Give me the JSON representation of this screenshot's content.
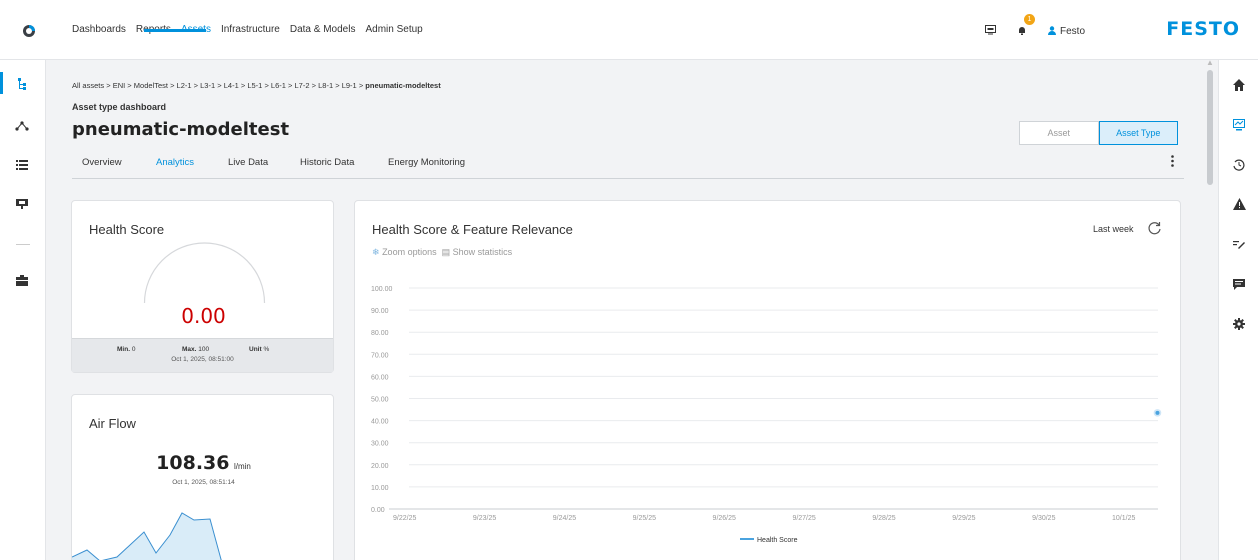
{
  "topnav": {
    "items": [
      "Dashboards",
      "Reports",
      "Assets",
      "Infrastructure",
      "Data & Models",
      "Admin Setup"
    ],
    "active": "Assets",
    "notification_count": "1",
    "user": "Festo",
    "brand": "FESTO"
  },
  "breadcrumb": {
    "items": [
      "All assets",
      "ENI",
      "ModelTest",
      "L2-1",
      "L3-1",
      "L4-1",
      "L5-1",
      "L6-1",
      "L7-2",
      "L8-1",
      "L9-1"
    ],
    "current": "pneumatic-modeltest",
    "separator": ">"
  },
  "header": {
    "subtitle": "Asset type dashboard",
    "title": "pneumatic-modeltest",
    "toggle_asset": "Asset",
    "toggle_asset_type": "Asset Type"
  },
  "tabs": [
    "Overview",
    "Analytics",
    "Live Data",
    "Historic Data",
    "Energy Monitoring"
  ],
  "active_tab": "Analytics",
  "health_card": {
    "title": "Health Score",
    "value": "0.00",
    "min_label": "Min.",
    "min_value": "0",
    "max_label": "Max.",
    "max_value": "100",
    "unit_label": "Unit",
    "unit_value": "%",
    "timestamp": "Oct 1, 2025, 08:51:00"
  },
  "airflow_card": {
    "title": "Air Flow",
    "value": "108.36",
    "unit": "l/min",
    "timestamp": "Oct 1, 2025, 08:51:14"
  },
  "chart_card": {
    "title": "Health Score & Feature Relevance",
    "zoom_options": "Zoom options",
    "show_statistics": "Show statistics",
    "range": "Last week"
  },
  "chart_data": {
    "type": "scatter",
    "title": "Health Score & Feature Relevance",
    "x_ticks": [
      "9/22/25",
      "9/23/25",
      "9/24/25",
      "9/25/25",
      "9/26/25",
      "9/27/25",
      "9/28/25",
      "9/29/25",
      "9/30/25",
      "10/1/25"
    ],
    "y_ticks": [
      "0.00",
      "10.00",
      "20.00",
      "30.00",
      "40.00",
      "50.00",
      "60.00",
      "70.00",
      "80.00",
      "90.00",
      "100.00"
    ],
    "ylim": [
      0,
      100
    ],
    "grid": true,
    "legend": "bottom",
    "series": [
      {
        "name": "Health Score",
        "color": "#4aa3df",
        "points": [
          {
            "x": "10/1/25 08:51",
            "y": 43.5
          }
        ]
      }
    ]
  },
  "colors": {
    "accent": "#0091dc",
    "gauge_value": "#cc0000"
  }
}
